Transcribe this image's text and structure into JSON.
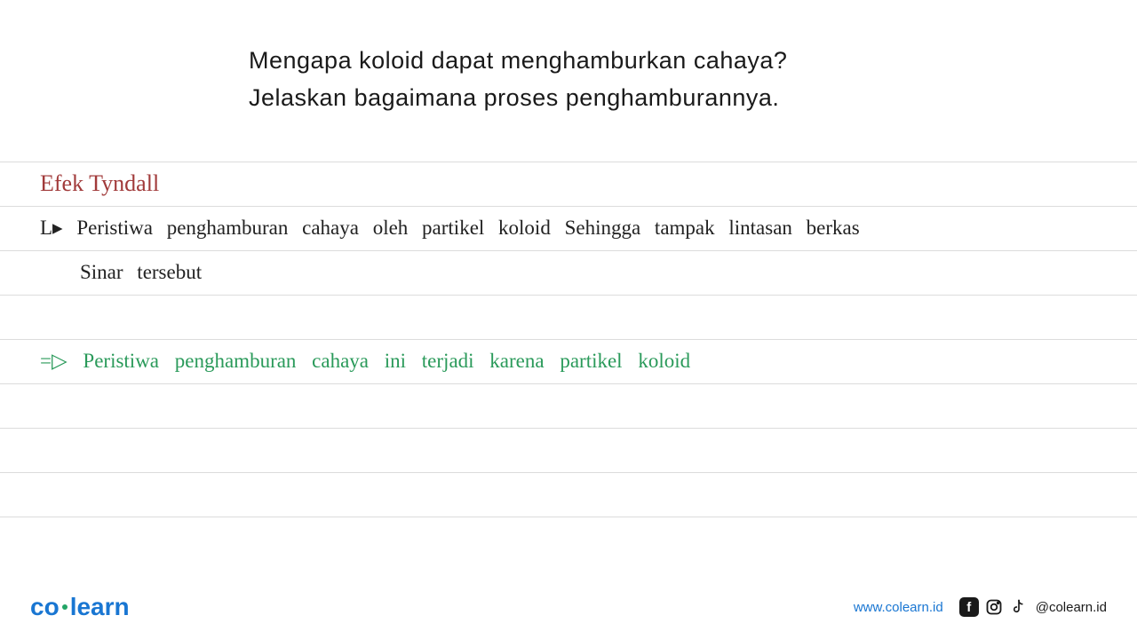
{
  "question": {
    "line1": "Mengapa koloid dapat menghamburkan cahaya?",
    "line2": "Jelaskan bagaimana proses penghamburannya."
  },
  "notes": {
    "title": "Efek Tyndall",
    "def_line1": "L▸ Peristiwa penghamburan cahaya oleh partikel koloid Sehingga tampak lintasan berkas",
    "def_line2": "Sinar tersebut",
    "expl_line1": "=▷ Peristiwa penghamburan cahaya ini terjadi karena partikel koloid"
  },
  "footer": {
    "logo_co": "co",
    "logo_learn": "learn",
    "website": "www.colearn.id",
    "handle": "@colearn.id"
  }
}
